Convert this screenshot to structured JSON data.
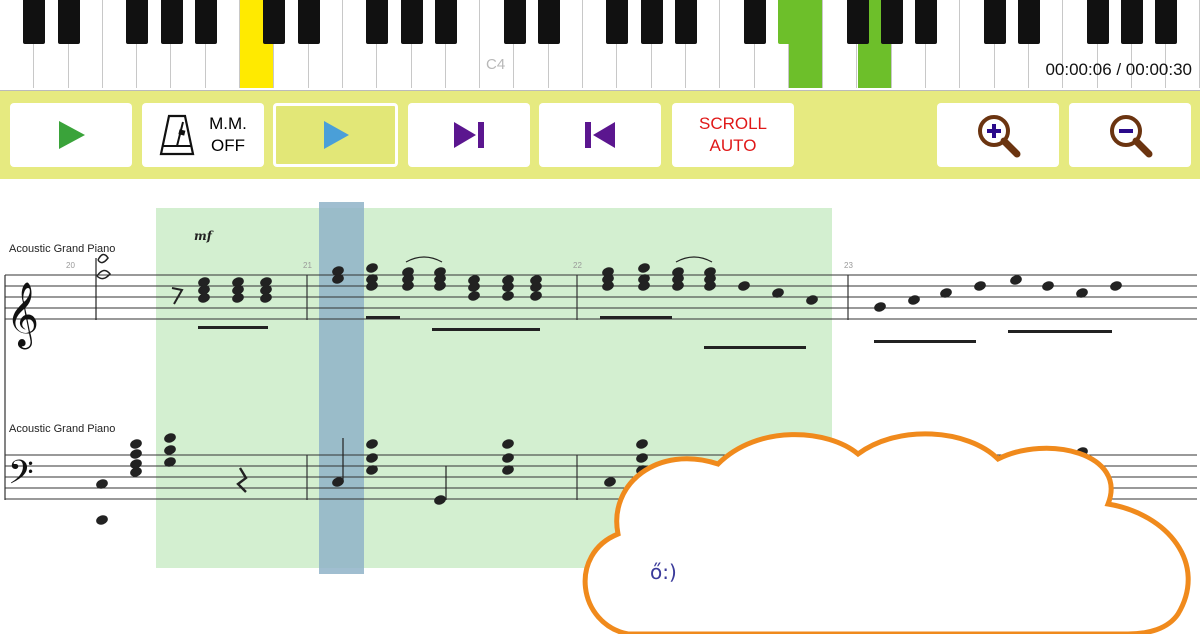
{
  "piano": {
    "key_label": "C4",
    "time_display": "00:00:06 / 00:00:30",
    "highlight_colors": {
      "current": "#ffea00",
      "played": "#6dbf2a"
    }
  },
  "toolbar": {
    "play_icon": "play-icon",
    "metronome_icon": "metronome-icon",
    "metronome_label_line1": "M.M.",
    "metronome_label_line2": "OFF",
    "play_highlighted_icon": "play-icon",
    "skip_forward_icon": "skip-forward-icon",
    "skip_back_icon": "skip-back-icon",
    "scroll_label_line1": "SCROLL",
    "scroll_label_line2": "AUTO",
    "zoom_in_icon": "zoom-in-icon",
    "zoom_out_icon": "zoom-out-icon",
    "colors": {
      "bar": "#e6ea80",
      "play_green": "#3aa33a",
      "play_blue": "#4a9fd8",
      "skip_purple": "#5b168f",
      "scroll_red": "#e01818",
      "zoom_brown": "#6b3410"
    }
  },
  "score": {
    "staff_labels": [
      "Acoustic Grand Piano",
      "Acoustic Grand Piano"
    ],
    "dynamic": "mf",
    "measure_numbers": [
      "20",
      "21",
      "22",
      "23"
    ],
    "colors": {
      "selection": "#d3efd0",
      "cursor": "#8fb3c8"
    }
  },
  "overlay": {
    "scribble_text": "ő:)"
  }
}
